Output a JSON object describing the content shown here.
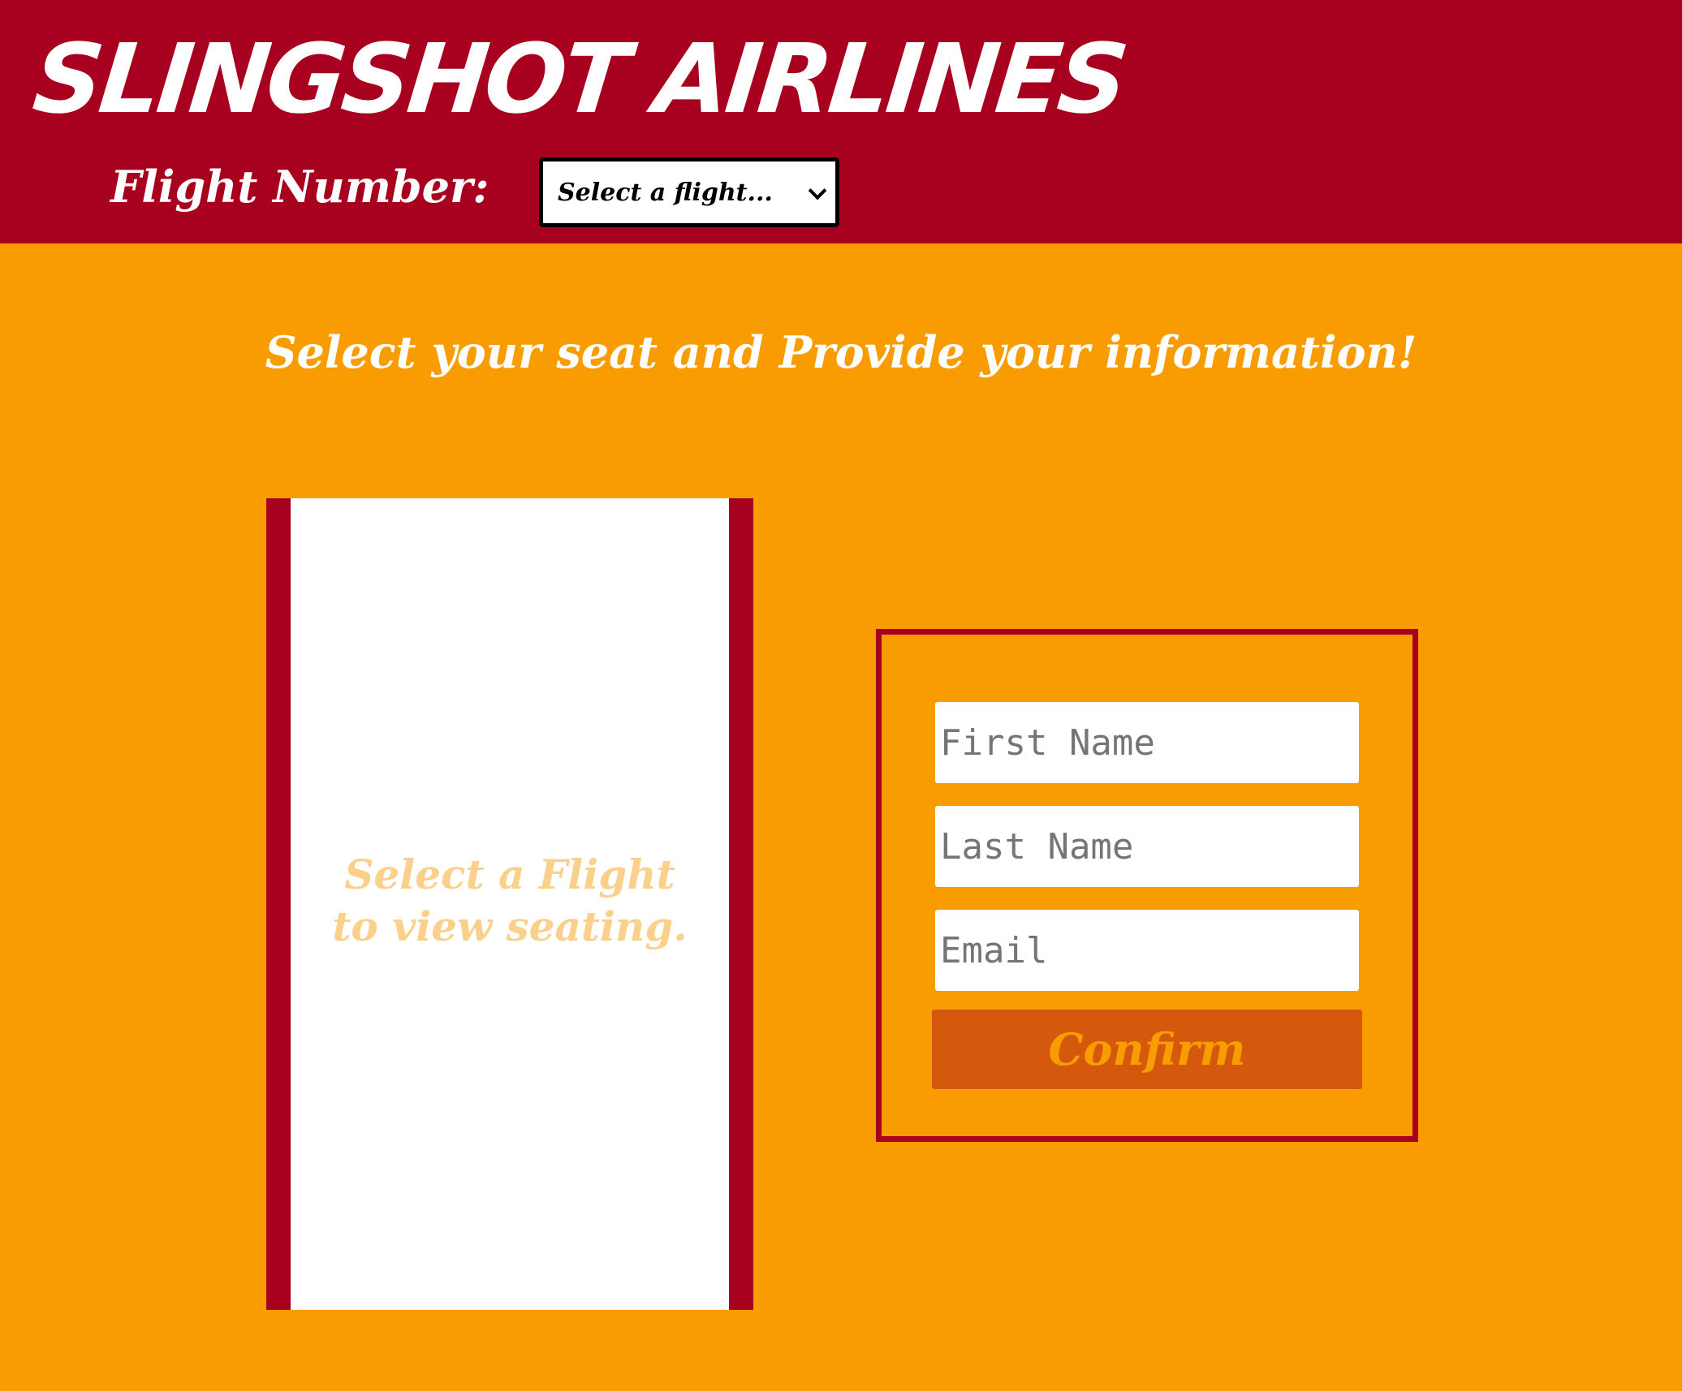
{
  "header": {
    "brand": "SLINGSHOT AIRLINES",
    "flight_label": "Flight Number:",
    "flight_select": {
      "selected": "Select a flight...",
      "icon": "chevron-down-icon"
    }
  },
  "main": {
    "headline": "Select your seat and Provide your information!",
    "seat_map": {
      "placeholder": "Select a Flight\nto view seating."
    },
    "form": {
      "first_name_placeholder": "First Name",
      "last_name_placeholder": "Last Name",
      "email_placeholder": "Email",
      "first_name_value": "",
      "last_name_value": "",
      "email_value": "",
      "confirm_label": "Confirm"
    }
  },
  "colors": {
    "header_bg": "#a8001f",
    "page_bg": "#f89c02",
    "button_bg": "#d5590c",
    "button_text": "#f89c02",
    "placeholder_text": "#fbd08a"
  }
}
